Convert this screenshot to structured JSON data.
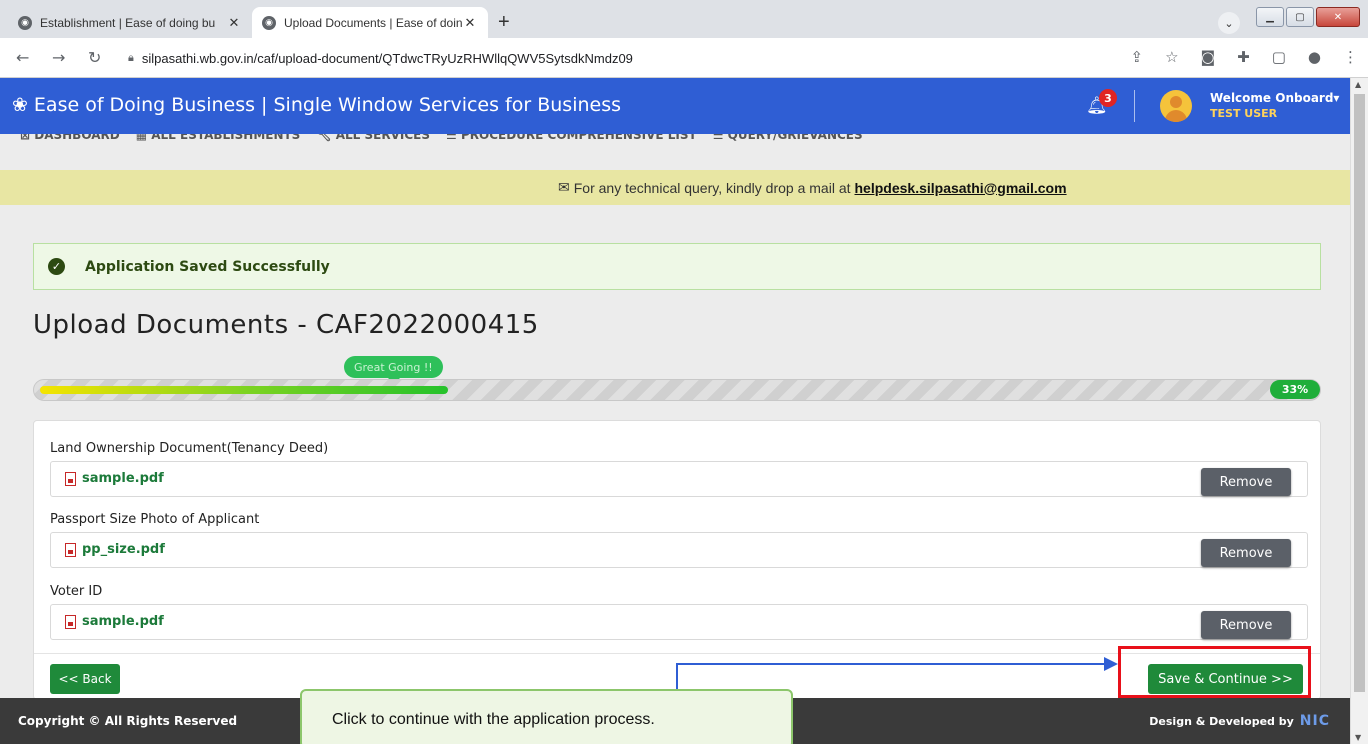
{
  "browser": {
    "tabs": [
      {
        "title": "Establishment | Ease of doing bu",
        "close": "✕"
      },
      {
        "title": "Upload Documents | Ease of doin",
        "close": "✕"
      }
    ],
    "new_tab": "+",
    "url": "silpasathi.wb.gov.in/caf/upload-document/QTdwcTRyUzRHWllqQWV5SytsdkNmdz09"
  },
  "header": {
    "title": "Ease of Doing Business | Single Window Services for Business",
    "notification_count": "3",
    "welcome": "Welcome Onboard",
    "user": "TEST USER"
  },
  "nav": {
    "items": [
      "DASHBOARD",
      "ALL ESTABLISHMENTS",
      "ALL SERVICES",
      "PROCEDURE COMPREHENSIVE LIST",
      "QUERY/GRIEVANCES"
    ]
  },
  "notice": {
    "text": "For any technical query, kindly drop a mail at",
    "email": "helpdesk.silpasathi@gmail.com"
  },
  "alert": {
    "message": "Application Saved Successfully"
  },
  "page": {
    "title": "Upload Documents - CAF2022000415"
  },
  "progress": {
    "tooltip": "Great Going !!",
    "percent_label": "33%",
    "value": 0.32
  },
  "documents": [
    {
      "label": "Land Ownership Document(Tenancy Deed)",
      "file": "sample.pdf",
      "action": "Remove"
    },
    {
      "label": "Passport Size Photo of Applicant",
      "file": "pp_size.pdf",
      "action": "Remove"
    },
    {
      "label": "Voter ID",
      "file": "sample.pdf",
      "action": "Remove"
    }
  ],
  "actions": {
    "back": "<< Back",
    "save": "Save & Continue >>"
  },
  "callout": {
    "text": "Click to continue with the application process."
  },
  "footer": {
    "copyright": "Copyright © All Rights Reserved",
    "developed": "Design & Developed by",
    "nic": "NIC"
  },
  "colors": {
    "header": "#2f5ed4",
    "primary_green": "#1f8a3a",
    "highlight_red": "#e8101a"
  }
}
